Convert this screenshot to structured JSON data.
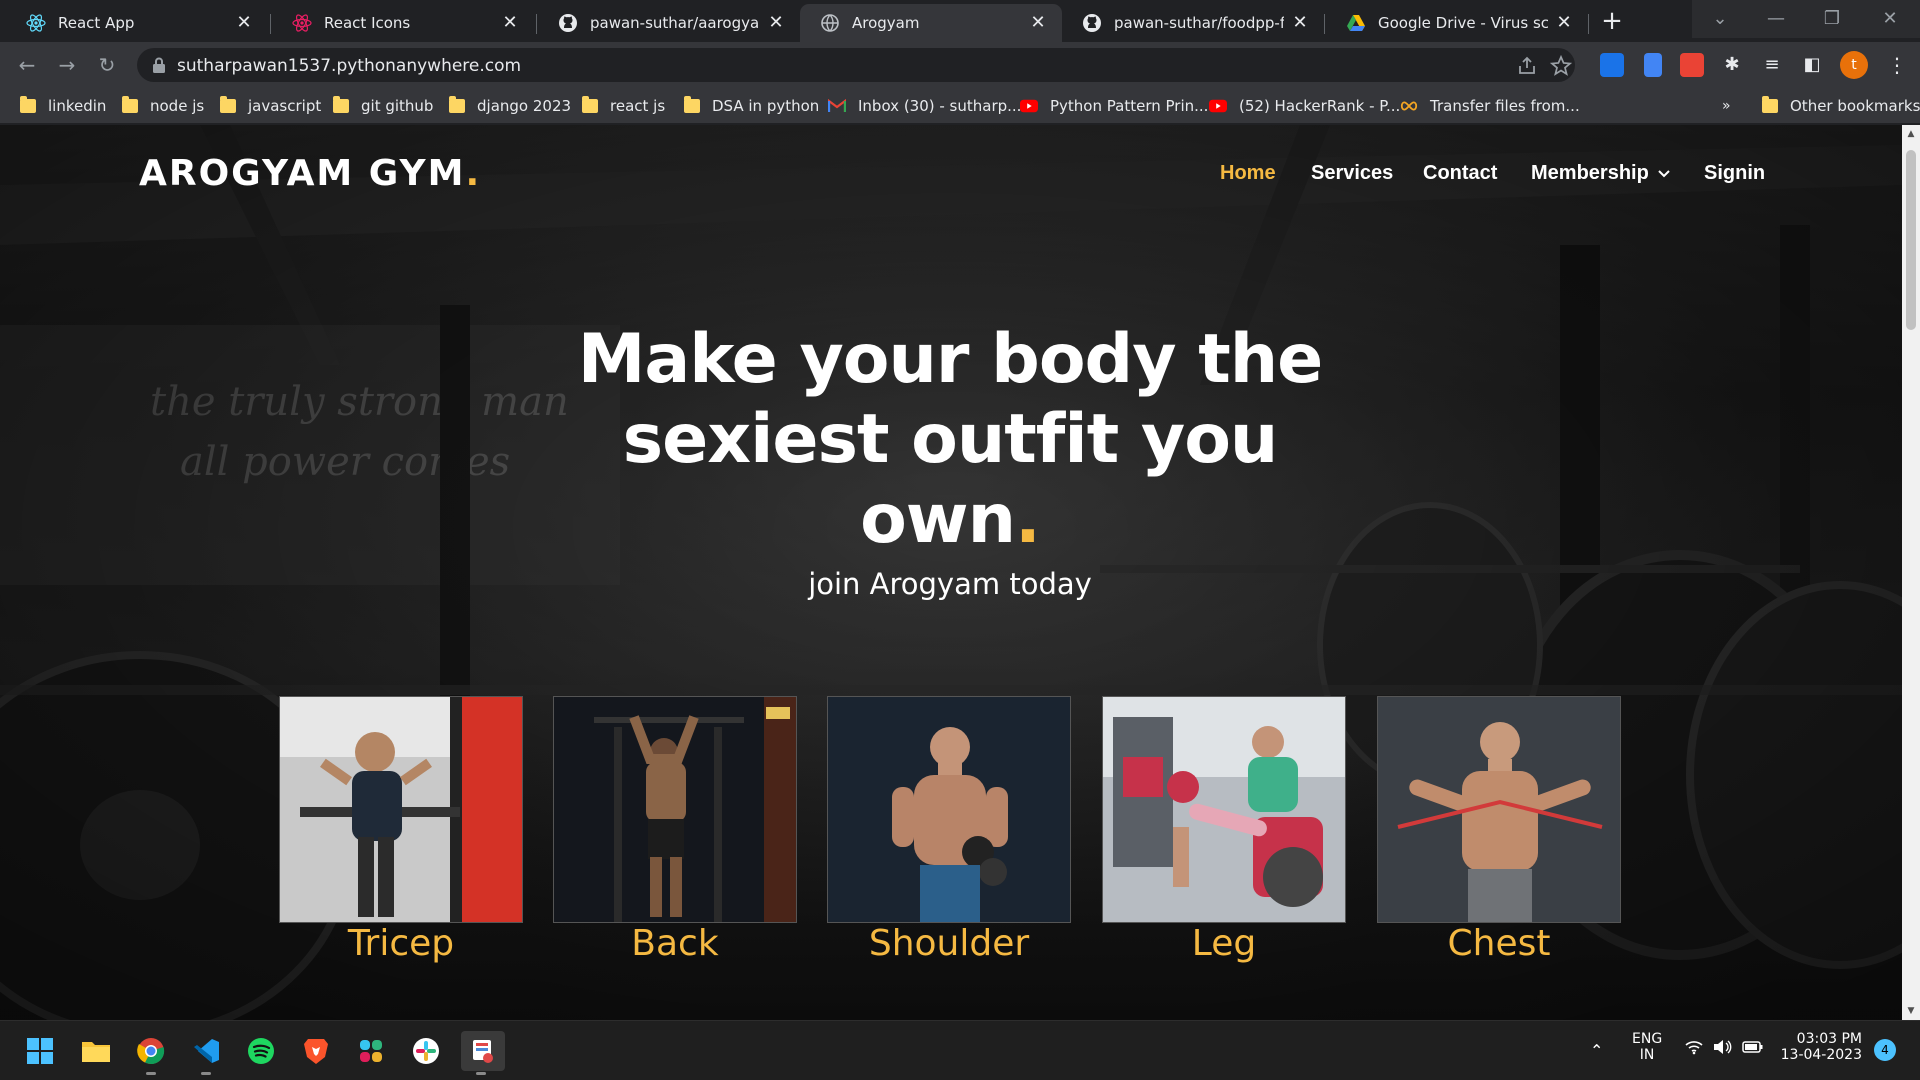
{
  "browser": {
    "tabs": [
      {
        "title": "React App",
        "favicon": "react-icon"
      },
      {
        "title": "React Icons",
        "favicon": "react-icons-icon"
      },
      {
        "title": "pawan-suthar/aarogyam-gy",
        "favicon": "github-icon"
      },
      {
        "title": "Arogyam",
        "favicon": "globe-icon",
        "active": true
      },
      {
        "title": "pawan-suthar/foodpp-flutt",
        "favicon": "github-icon"
      },
      {
        "title": "Google Drive - Virus scan w",
        "favicon": "google-drive-icon"
      }
    ],
    "new_tab_label": "+",
    "url": "sutharpawan1537.pythonanywhere.com",
    "profile_initial": "t",
    "bookmarks": [
      {
        "label": "linkedin",
        "icon": "folder-icon"
      },
      {
        "label": "node js",
        "icon": "folder-icon"
      },
      {
        "label": "javascript",
        "icon": "folder-icon"
      },
      {
        "label": "git github",
        "icon": "folder-icon"
      },
      {
        "label": "django 2023",
        "icon": "folder-icon"
      },
      {
        "label": "react js",
        "icon": "folder-icon"
      },
      {
        "label": "DSA in python",
        "icon": "folder-icon"
      },
      {
        "label": "Inbox (30) - sutharp...",
        "icon": "gmail-icon"
      },
      {
        "label": "Python Pattern Prin...",
        "icon": "youtube-icon"
      },
      {
        "label": "(52) HackerRank - P...",
        "icon": "youtube-icon"
      },
      {
        "label": "Transfer files from...",
        "icon": "infinity-icon"
      }
    ],
    "bookmarks_overflow": "»",
    "other_bookmarks": "Other bookmarks"
  },
  "page": {
    "brand": "AROGYAM GYM",
    "brand_dot": ".",
    "nav": [
      {
        "label": "Home",
        "active": true
      },
      {
        "label": "Services"
      },
      {
        "label": "Contact"
      },
      {
        "label": "Membership",
        "dropdown": true
      },
      {
        "label": "Signin"
      }
    ],
    "hero": {
      "line1": "Make your body the",
      "line2": "sexiest outfit you",
      "line3": "own",
      "dot": ".",
      "subtitle": "join Arogyam today"
    },
    "workouts": [
      {
        "label": "Tricep",
        "image": "tricep-dips-photo"
      },
      {
        "label": "Back",
        "image": "pull-up-photo"
      },
      {
        "label": "Shoulder",
        "image": "dumbbell-photo"
      },
      {
        "label": "Leg",
        "image": "leg-machine-photo"
      },
      {
        "label": "Chest",
        "image": "resistance-band-photo"
      }
    ]
  },
  "taskbar": {
    "apps": [
      "windows-start-icon",
      "file-explorer-icon",
      "chrome-icon",
      "vscode-icon",
      "spotify-icon",
      "brave-icon",
      "slack-icon",
      "slack-icon",
      "snipping-tool-icon"
    ],
    "language": "ENG",
    "region": "IN",
    "time": "03:03 PM",
    "date": "13-04-2023",
    "notifications": "4"
  },
  "colors": {
    "accent": "#f5b942",
    "chrome_bg": "#202124",
    "toolbar_bg": "#35363a"
  }
}
